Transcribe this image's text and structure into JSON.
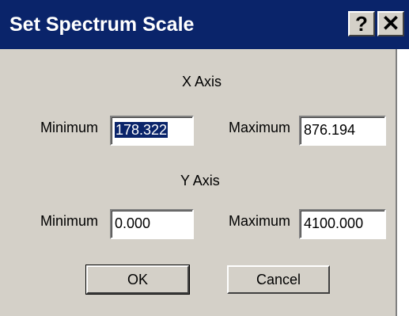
{
  "window": {
    "title": "Set Spectrum Scale",
    "help_glyph": "?",
    "close_glyph": "✕"
  },
  "x_axis": {
    "heading": "X Axis",
    "min_label": "Minimum",
    "min_value": "178.322",
    "max_label": "Maximum",
    "max_value": "876.194"
  },
  "y_axis": {
    "heading": "Y Axis",
    "min_label": "Minimum",
    "min_value": "0.000",
    "max_label": "Maximum",
    "max_value": "4100.000"
  },
  "buttons": {
    "ok": "OK",
    "cancel": "Cancel"
  },
  "colors": {
    "titlebar": "#0a246a",
    "dialog_face": "#d4d0c8",
    "selection": "#0a246a"
  }
}
